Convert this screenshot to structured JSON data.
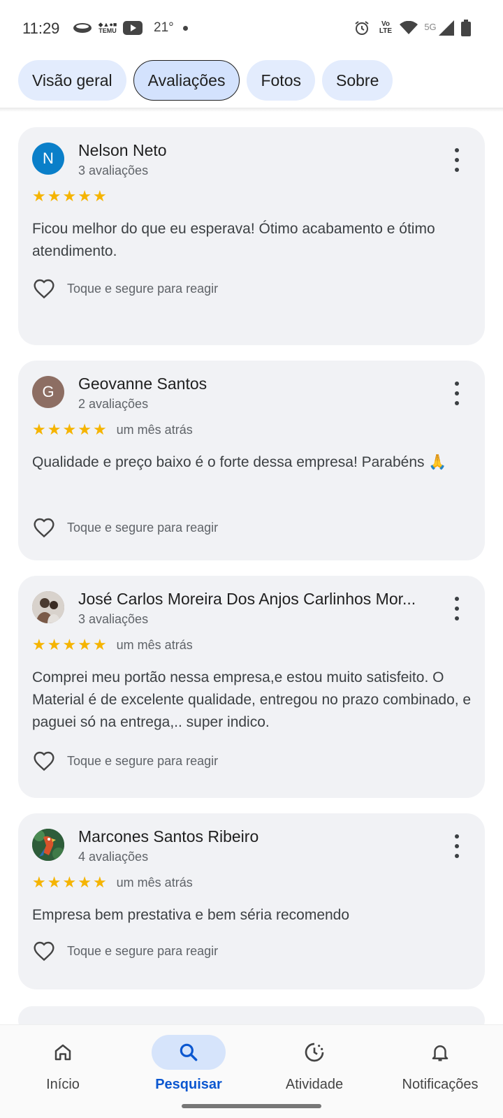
{
  "status_bar": {
    "time": "11:29",
    "temu_label": "TEMU",
    "temperature": "21°",
    "network": "5G",
    "volte": "Vo LTE"
  },
  "tabs": [
    {
      "label": "Visão geral",
      "active": false
    },
    {
      "label": "Avaliações",
      "active": true
    },
    {
      "label": "Fotos",
      "active": false
    },
    {
      "label": "Sobre",
      "active": false
    }
  ],
  "reviews": [
    {
      "avatar_letter": "N",
      "avatar_color": "#0a7fc9",
      "name": "Nelson Neto",
      "count": "3 avaliações",
      "stars": 5,
      "date": "",
      "text": "Ficou melhor do que eu esperava! Ótimo acabamento e ótimo atendimento.",
      "react_label": "Toque e segure para reagir"
    },
    {
      "avatar_letter": "G",
      "avatar_color": "#8d6e63",
      "name": "Geovanne Santos",
      "count": "2 avaliações",
      "stars": 5,
      "date": "um mês atrás",
      "text": "Qualidade e preço baixo é o forte dessa empresa! Parabéns 🙏",
      "react_label": "Toque e segure para reagir"
    },
    {
      "avatar_letter": "",
      "avatar_color": "#9e8f86",
      "name": "José Carlos Moreira Dos Anjos Carlinhos Mor...",
      "count": "3 avaliações",
      "stars": 5,
      "date": "um mês atrás",
      "text": "Comprei meu portão nessa empresa,e estou muito satisfeito. O Material é de excelente qualidade, entregou no prazo combinado, e paguei só na entrega,.. super indico.",
      "react_label": "Toque e segure para reagir"
    },
    {
      "avatar_letter": "",
      "avatar_color": "#2e5d3a",
      "name": "Marcones Santos Ribeiro",
      "count": "4 avaliações",
      "stars": 5,
      "date": "um mês atrás",
      "text": "Empresa bem prestativa e bem séria recomendo",
      "react_label": "Toque e segure para reagir"
    }
  ],
  "bottom_nav": [
    {
      "label": "Início",
      "icon": "home-icon",
      "active": false
    },
    {
      "label": "Pesquisar",
      "icon": "search-icon",
      "active": true
    },
    {
      "label": "Atividade",
      "icon": "activity-icon",
      "active": false
    },
    {
      "label": "Notificações",
      "icon": "bell-icon",
      "active": false
    }
  ],
  "colors": {
    "star": "#f5b400",
    "accent": "#0b57d0",
    "card_bg": "#f1f2f5",
    "tab_bg": "#e3ecfd"
  }
}
